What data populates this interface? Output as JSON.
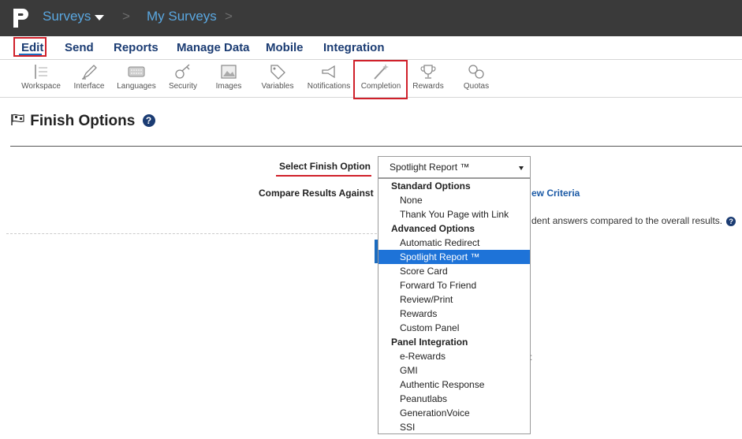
{
  "breadcrumb": {
    "surveys": "Surveys",
    "separator": ">",
    "my_surveys": "My Surveys"
  },
  "menu": [
    "Edit",
    "Send",
    "Reports",
    "Manage Data",
    "Mobile",
    "Integration"
  ],
  "toolbar": [
    {
      "label": "Workspace",
      "icon": "workspace-icon"
    },
    {
      "label": "Interface",
      "icon": "pen-icon"
    },
    {
      "label": "Languages",
      "icon": "keyboard-icon"
    },
    {
      "label": "Security",
      "icon": "key-icon"
    },
    {
      "label": "Images",
      "icon": "image-icon"
    },
    {
      "label": "Variables",
      "icon": "tag-icon"
    },
    {
      "label": "Notifications",
      "icon": "megaphone-icon"
    },
    {
      "label": "Completion",
      "icon": "magic-wand-icon"
    },
    {
      "label": "Rewards",
      "icon": "trophy-icon"
    },
    {
      "label": "Quotas",
      "icon": "links-icon"
    }
  ],
  "page": {
    "title": "Finish Options",
    "title_icon": "checkered-flag-icon",
    "help": "?"
  },
  "form": {
    "select_label": "Select Finish Option",
    "select_value": "Spotlight Report ™",
    "compare_label": "Compare Results Against",
    "view_criteria": "ew Criteria",
    "description": "dent answers compared to the overall results.",
    "faint_char": ":"
  },
  "dropdown": {
    "groups": [
      {
        "label": "Standard Options",
        "options": [
          "None",
          "Thank You Page with Link"
        ]
      },
      {
        "label": "Advanced Options",
        "options": [
          "Automatic Redirect",
          "Spotlight Report ™",
          "Score Card",
          "Forward To Friend",
          "Review/Print",
          "Rewards",
          "Custom Panel"
        ]
      },
      {
        "label": "Panel Integration",
        "options": [
          "e-Rewards",
          "GMI",
          "Authentic Response",
          "Peanutlabs",
          "GenerationVoice",
          "SSI"
        ]
      }
    ],
    "selected": "Spotlight Report ™"
  },
  "colors": {
    "topbar": "#3a3a3a",
    "link": "#5aa7e0",
    "menu": "#1b3c73",
    "highlight_box": "#d0202a",
    "selected_option": "#1e73d8"
  }
}
